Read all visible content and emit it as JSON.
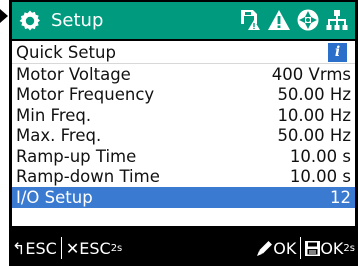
{
  "header": {
    "title": "Setup",
    "background": "#009a7e",
    "icons": [
      "gear-icon",
      "sd-card-warning-icon",
      "warning-triangle-icon",
      "navigation-wheel-icon",
      "network-tree-icon"
    ]
  },
  "panel": {
    "section_title": "Quick Setup",
    "info_label": "i",
    "items": [
      {
        "label": "Motor Voltage",
        "value": "400 Vrms"
      },
      {
        "label": "Motor Frequency",
        "value": "50.00 Hz"
      },
      {
        "label": "Min Freq.",
        "value": "10.00 Hz"
      },
      {
        "label": "Max. Freq.",
        "value": "50.00 Hz"
      },
      {
        "label": "Ramp-up Time",
        "value": "10.00 s"
      },
      {
        "label": "Ramp-down Time",
        "value": "10.00 s"
      },
      {
        "label": "I/O Setup",
        "value": "12",
        "selected": true
      }
    ],
    "selection_color": "#3a7ad1"
  },
  "footer": {
    "back_arrow": "↰",
    "esc_label": "ESC",
    "esc_long_prefix": "✕",
    "esc_long_label": "ESC",
    "esc_long_sub": "2s",
    "edit_label": "OK",
    "save_label": "OK",
    "save_sub": "2s"
  }
}
